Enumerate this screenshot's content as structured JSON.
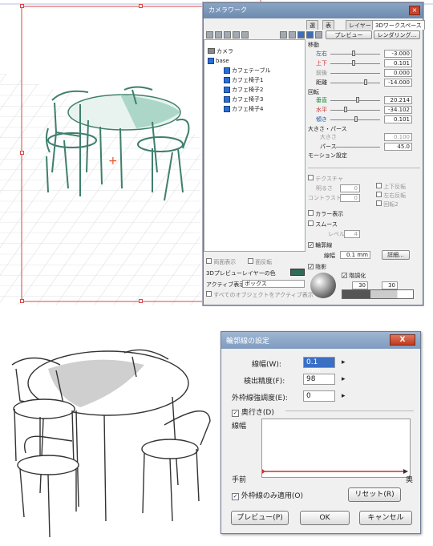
{
  "panel": {
    "title": "カメラワーク",
    "tabs": [
      "選",
      "表",
      "レイヤー",
      "3Dワークスペース"
    ],
    "toolbar": {
      "preview_label": "プレビュー",
      "render_label": "レンダリング..."
    },
    "tree": {
      "camera": "カメラ",
      "base": "base",
      "items": [
        "カフェテーブル",
        "カフェ椅子1",
        "カフェ椅子2",
        "カフェ椅子3",
        "カフェ椅子4"
      ]
    },
    "move": {
      "heading": "移動",
      "rows": [
        {
          "label": "左右",
          "value": "-3.000"
        },
        {
          "label": "上下",
          "value": "0.101"
        },
        {
          "label": "前後",
          "value": "0.000"
        },
        {
          "label": "距離",
          "value": "-14.000"
        }
      ]
    },
    "rotate": {
      "heading": "回転",
      "rows": [
        {
          "label": "垂直",
          "value": "20.214"
        },
        {
          "label": "水平",
          "value": "-34.102"
        },
        {
          "label": "傾き",
          "value": "0.101"
        }
      ]
    },
    "perspective": {
      "heading": "大きさ・パース",
      "size_label": "大きさ",
      "size_value": "0.100",
      "pers_label": "パース",
      "pers_value": "45.0"
    },
    "motion": {
      "heading": "モーション設定"
    },
    "texture": {
      "label": "テクスチャ",
      "brightness_label": "明るさ",
      "brightness_value": "0",
      "contrast_label": "コントラスト",
      "contrast_value": "0",
      "opt1": "上下反転",
      "opt2": "左右反転",
      "opt3": "回転2"
    },
    "color_display": "カラー表示",
    "smooth": {
      "label": "スムース",
      "level_label": "レベル",
      "level_value": "4"
    },
    "outline": {
      "label": "輪郭線",
      "width_label": "線幅",
      "width_value": "0.1 mm",
      "detail_button": "詳細..."
    },
    "shading": {
      "label": "陰影",
      "tone_label": "階調化",
      "tone_a": "30",
      "tone_b": "30"
    },
    "bottom": {
      "backface": "両面表示",
      "reverse": "面反転",
      "layer_color": "3Dプレビューレイヤーの色",
      "active_label": "アクティブ表示:",
      "active_value": "ボックス",
      "all_active": "すべてのオブジェクトをアクティブ表示"
    }
  },
  "dialog": {
    "title": "輪郭線の設定",
    "close_label": "X",
    "line_width_label": "線幅(W):",
    "line_width_value": "0.1 mm",
    "precision_label": "検出精度(F):",
    "precision_value": "98",
    "outer_emph_label": "外枠線強調度(E):",
    "outer_emph_value": "0",
    "depth_label": "奥行き(D)",
    "graph_label": "線幅",
    "near_label": "手前",
    "far_label": "奥",
    "apply_outer_label": "外枠線のみ適用(O)",
    "reset_button": "リセット(R)",
    "preview_button": "プレビュー(P)",
    "ok_button": "OK",
    "cancel_button": "キャンセル"
  }
}
